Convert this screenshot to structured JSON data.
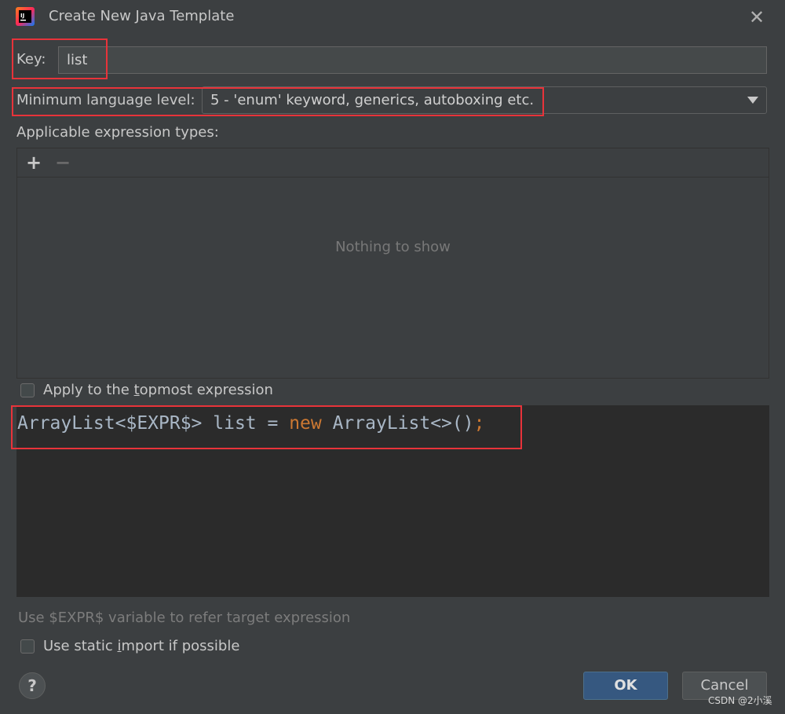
{
  "window": {
    "title": "Create New Java Template",
    "close_glyph": "✕",
    "logo_icon": "intellij-idea-icon",
    "logo_text": "IJ"
  },
  "key": {
    "label": "Key:",
    "value": "list"
  },
  "language_level": {
    "label": "Minimum language level:",
    "selected": "5 - 'enum' keyword, generics, autoboxing etc.",
    "arrow_icon": "dropdown-arrow-icon"
  },
  "expression_types": {
    "label": "Applicable expression types:",
    "add_glyph": "+",
    "remove_glyph": "−",
    "empty_text": "Nothing to show"
  },
  "topmost": {
    "label_pre": "Apply to the ",
    "mnemonic": "t",
    "label_post": "opmost expression",
    "checked": false
  },
  "editor": {
    "code_part1": "ArrayList<$EXPR$> list = ",
    "code_keyword": "new",
    "code_part2": " ArrayList<>()",
    "code_semicolon": ";"
  },
  "hint": "Use $EXPR$ variable to refer target expression",
  "static_import": {
    "label_pre": "Use static ",
    "mnemonic": "i",
    "label_post": "mport if possible",
    "checked": false
  },
  "buttons": {
    "help": "?",
    "ok": "OK",
    "cancel": "Cancel"
  },
  "watermark": "CSDN @2小溪",
  "colors": {
    "background": "#3c3f41",
    "editor_background": "#2b2b2b",
    "keyword": "#cc7832",
    "highlight_box": "#e8333a",
    "ok_button": "#365880"
  }
}
